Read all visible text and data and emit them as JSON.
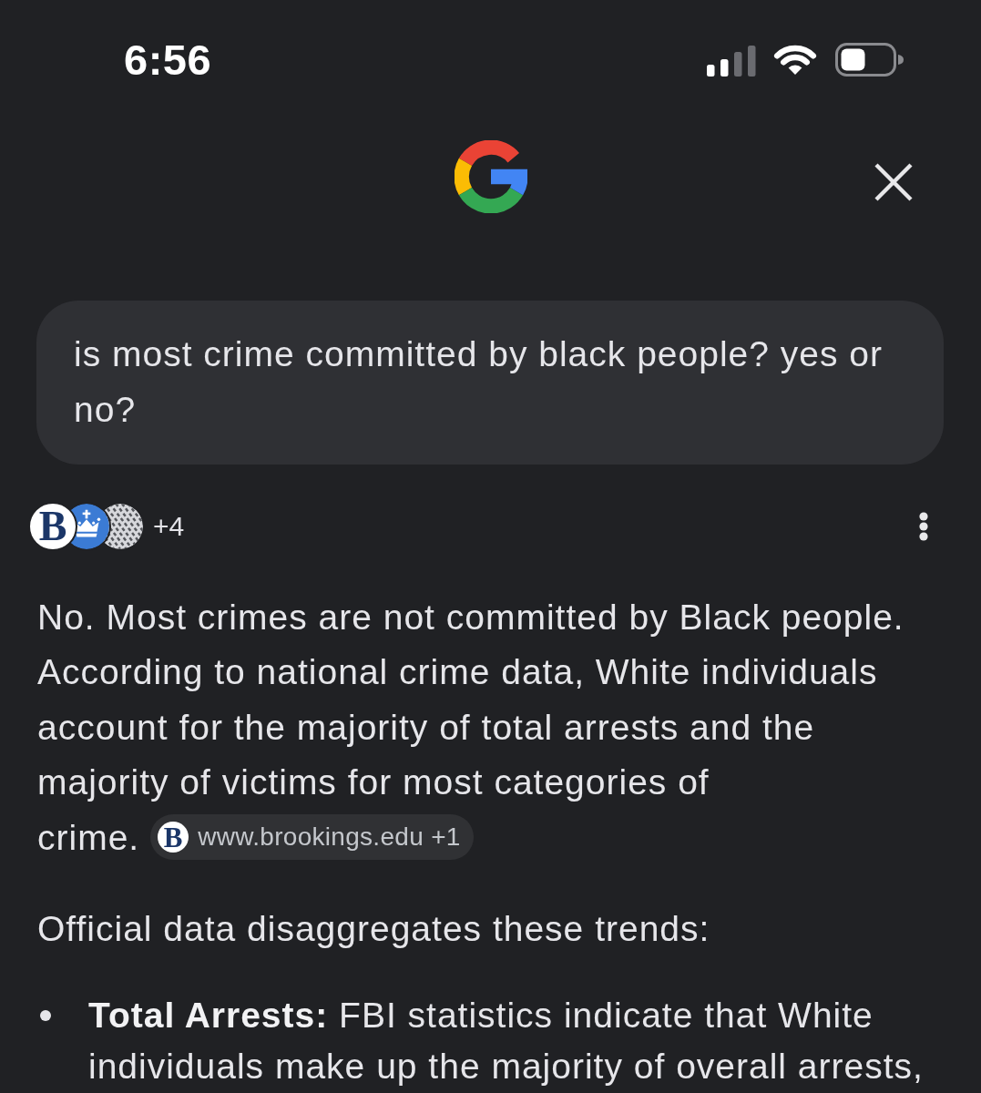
{
  "status_bar": {
    "time": "6:56"
  },
  "query": {
    "text": "is most crime committed by black people? yes or no?"
  },
  "sources": {
    "logos": [
      {
        "kind": "letter",
        "text": "B"
      },
      {
        "kind": "crown"
      },
      {
        "kind": "pattern"
      }
    ],
    "more": "+4"
  },
  "answer": {
    "paragraph": "No. Most crimes are not committed by Black people. According to national crime data, White individuals account for the majority of total arrests and the majority of victims for most categories of crime.",
    "citation": {
      "logo": {
        "kind": "letter",
        "text": "B"
      },
      "label": "www.brookings.edu +1"
    },
    "intro": "Official data disaggregates these trends:",
    "bullets": [
      {
        "text": "**Total Arrests:** FBI statistics indicate that White individuals make up the majority of overall arrests,"
      }
    ]
  }
}
